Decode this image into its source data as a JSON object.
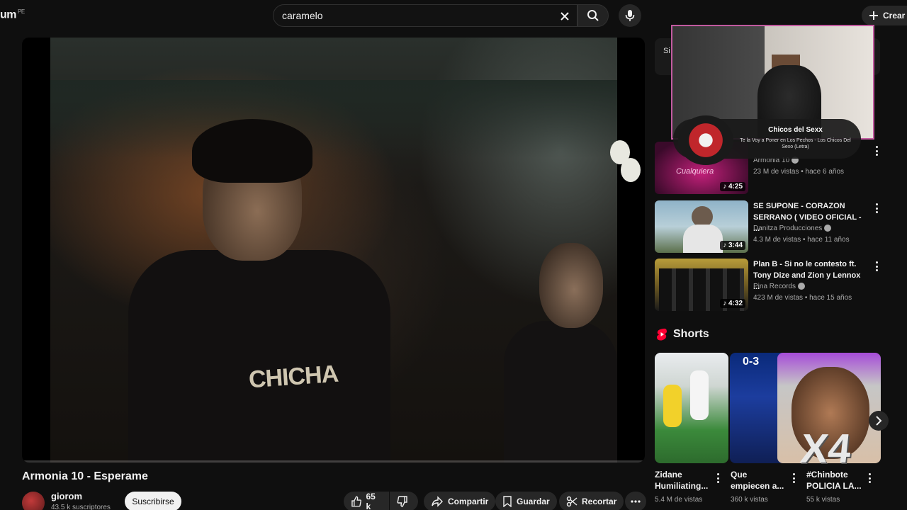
{
  "header": {
    "logo_text": "um",
    "country_code": "PE",
    "search_value": "caramelo",
    "create_label": "Crear"
  },
  "video": {
    "title": "Armonia 10 - Esperame",
    "shirt_text": "CHICHA",
    "channel_name": "giorom",
    "channel_subs": "43.5 k suscriptores",
    "subscribe_label": "Suscribirse",
    "likes": "65 k",
    "share_label": "Compartir",
    "save_label": "Guardar",
    "clip_label": "Recortar"
  },
  "sidebar": {
    "chip_text": "Si",
    "recommendations": [
      {
        "title_line1": "",
        "title_line2": "",
        "channel": "Armonia 10",
        "meta": "23 M de vistas • hace 6 años",
        "duration": "4:25",
        "thumb_text": "Cualquiera"
      },
      {
        "title_line1": "SE SUPONE - CORAZON",
        "title_line2": "SERRANO ( VIDEO OFICIAL - ...",
        "channel": "Danitza Producciones",
        "meta": "4.3 M de vistas • hace 11 años",
        "duration": "3:44"
      },
      {
        "title_line1": "Plan B - Si no le contesto ft.",
        "title_line2": "Tony Dize and Zion y Lennox ...",
        "channel": "Pina Records",
        "meta": "423 M de vistas • hace 15 años",
        "duration": "4:32"
      }
    ],
    "shorts_label": "Shorts",
    "shorts": [
      {
        "title_line1": "Zidane",
        "title_line2": "Humiliating...",
        "views": "5.4 M de vistas"
      },
      {
        "title_line1": "Que",
        "title_line2": "empiecen a...",
        "views": "360 k vistas",
        "score": "0-3"
      },
      {
        "title_line1": "#Chinbote",
        "title_line2": "POLICIA LA...",
        "views": "55 k vistas",
        "overlay": "X4"
      }
    ]
  },
  "now_playing": {
    "title": "Chicos del Sexx",
    "subtitle": "Te la Voy a Poner en Los Pechos - Los Chicos Del Sexo (Letra)"
  },
  "colors": {
    "background": "#0f0f0f",
    "accent_red": "#ff0033",
    "webcam_border": "#c25aa0"
  }
}
